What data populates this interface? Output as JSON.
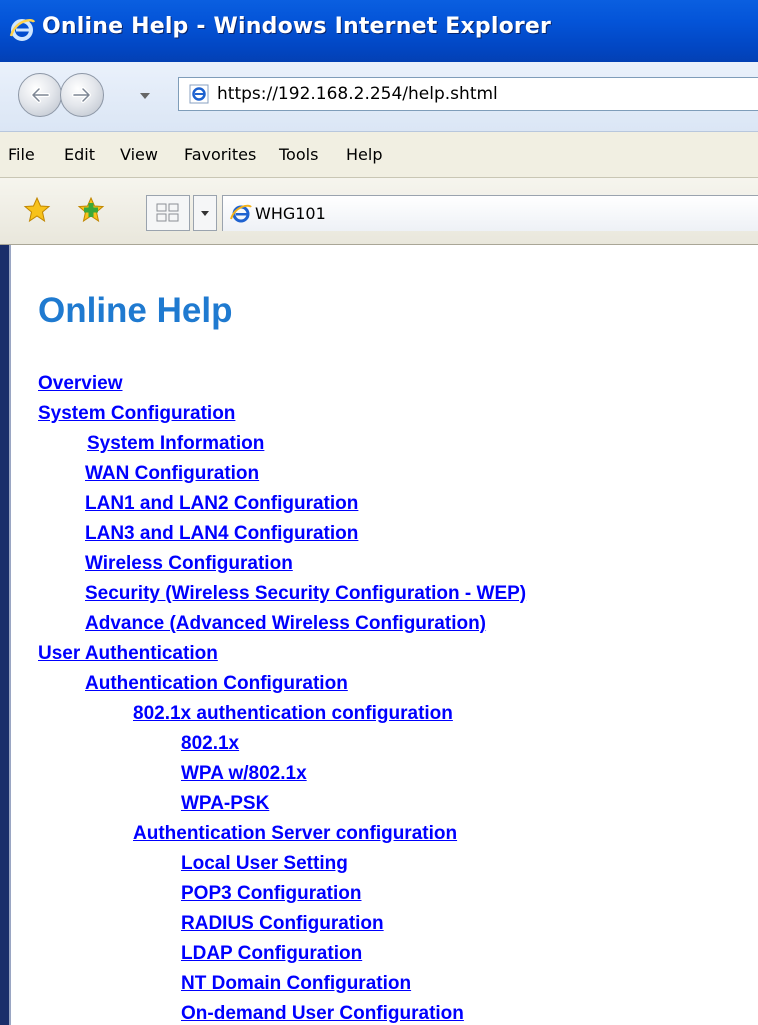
{
  "window": {
    "title": "Online Help - Windows Internet Explorer"
  },
  "address_bar": {
    "url": "https://192.168.2.254/help.shtml"
  },
  "menu": [
    "File",
    "Edit",
    "View",
    "Favorites",
    "Tools",
    "Help"
  ],
  "tab": {
    "label": "WHG101"
  },
  "icons": {
    "browser": "ie-logo-icon",
    "back": "back-arrow-icon",
    "forward": "forward-arrow-icon",
    "favorites": "favorites-star-icon",
    "add_favorite": "add-favorite-icon",
    "quick_tabs": "quick-tabs-icon",
    "tab_list": "chevron-down-icon"
  },
  "colors": {
    "titlebar": "#0454d8",
    "heading": "#1f7ad0",
    "link": "#0000ff"
  },
  "page": {
    "heading": "Online Help",
    "toc": [
      {
        "text": "Overview",
        "level": 0
      },
      {
        "text": "System Configuration",
        "level": 0
      },
      {
        "text": "System Information",
        "level": 1
      },
      {
        "text": "WAN Configuration",
        "level": 1
      },
      {
        "text": "LAN1 and LAN2 Configuration",
        "level": 1
      },
      {
        "text": "LAN3 and LAN4 Configuration",
        "level": 1
      },
      {
        "text": "Wireless Configuration",
        "level": 1
      },
      {
        "text": "Security (Wireless Security Configuration - WEP)",
        "level": 1
      },
      {
        "text": "Advance (Advanced Wireless Configuration)",
        "level": 1
      },
      {
        "text": "User Authentication",
        "level": 0
      },
      {
        "text": "Authentication Configuration",
        "level": 1
      },
      {
        "text": "802.1x authentication configuration",
        "level": 2
      },
      {
        "text": "802.1x",
        "level": 3
      },
      {
        "text": "WPA w/802.1x",
        "level": 3
      },
      {
        "text": "WPA-PSK",
        "level": 3
      },
      {
        "text": "Authentication Server configuration",
        "level": 2
      },
      {
        "text": "Local User Setting",
        "level": 3
      },
      {
        "text": "POP3 Configuration",
        "level": 3
      },
      {
        "text": "RADIUS Configuration",
        "level": 3
      },
      {
        "text": "LDAP Configuration",
        "level": 3
      },
      {
        "text": "NT Domain Configuration",
        "level": 3
      },
      {
        "text": "On-demand User Configuration",
        "level": 3
      }
    ]
  }
}
